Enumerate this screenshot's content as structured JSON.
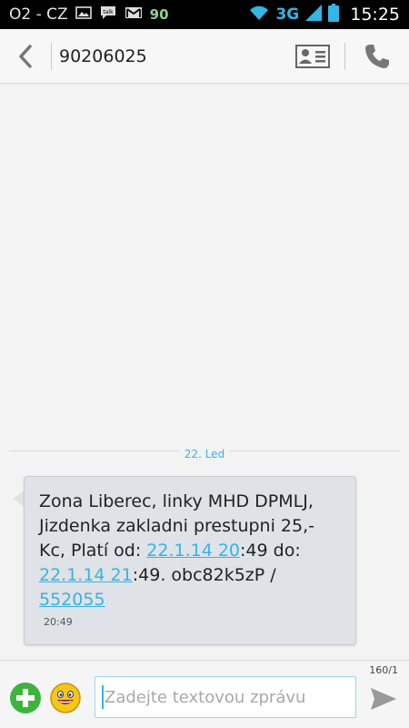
{
  "status_bar": {
    "carrier": "O2 - CZ",
    "notification_count": "90",
    "network_type": "3G",
    "time": "15:25",
    "icons": [
      "image-icon",
      "talk-icon",
      "gmail-icon",
      "wifi-icon",
      "signal-icon",
      "battery-icon"
    ]
  },
  "header": {
    "title": "90206025",
    "back_icon": "chevron-left-icon",
    "contact_icon": "contact-card-icon",
    "call_icon": "phone-icon"
  },
  "conversation": {
    "date_separator": "22. Led",
    "messages": [
      {
        "parts": [
          {
            "text": "Zona Liberec, linky MHD DPMLJ, Jizdenka zakladni prestupni 25,- Kc, Platí od: ",
            "link": false
          },
          {
            "text": "22.1.14 20",
            "link": true
          },
          {
            "text": ":49 do: ",
            "link": false
          },
          {
            "text": "22.1.14 21",
            "link": true
          },
          {
            "text": ":49. obc82k5zP / ",
            "link": false
          },
          {
            "text": "552055",
            "link": true
          }
        ],
        "time": "20:49"
      }
    ]
  },
  "compose": {
    "char_counter": "160/1",
    "placeholder": "Zadejte textovou zprávu",
    "value": "",
    "add_icon": "add-attachment-icon",
    "emoji_icon": "emoji-icon",
    "send_icon": "send-icon"
  },
  "colors": {
    "accent": "#33b5e5",
    "bubble": "#dfe2e6",
    "background": "#f3f3f3",
    "add_green": "#3db43d"
  }
}
